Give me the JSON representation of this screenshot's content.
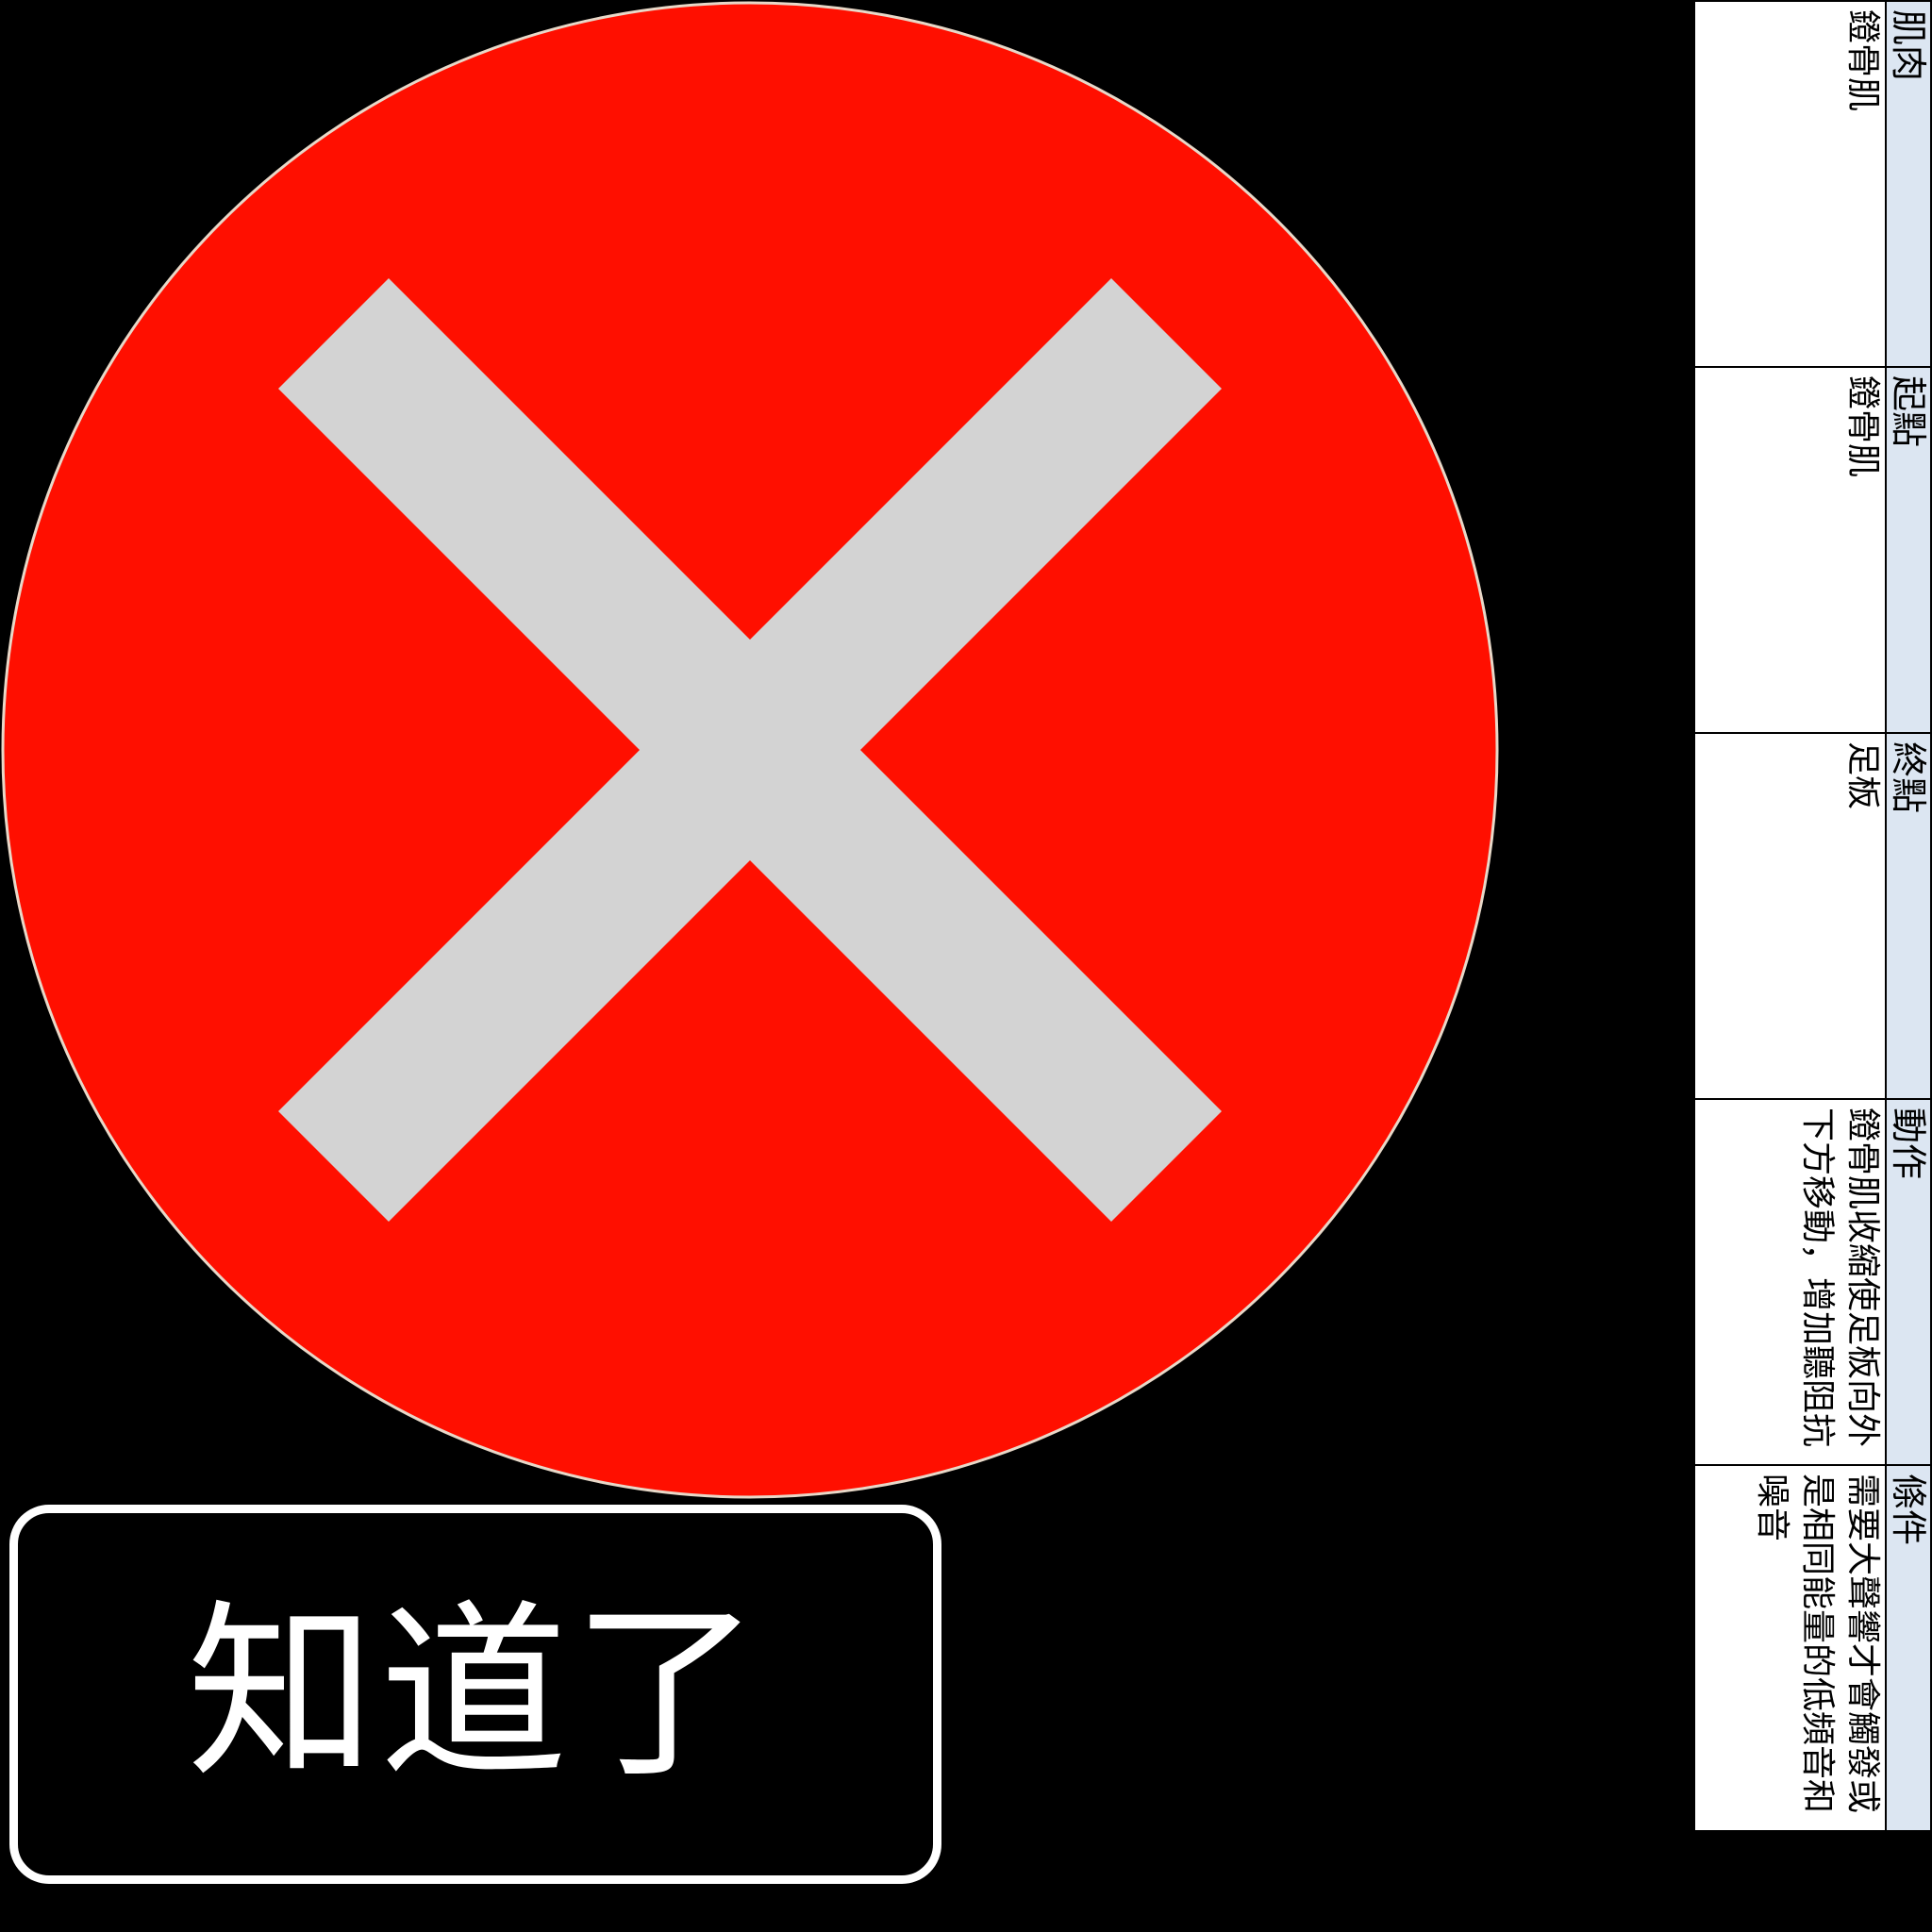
{
  "dialog": {
    "ok_button_label": "知道了"
  },
  "colors": {
    "circle_fill": "#ff0f00",
    "cross_fill": "#d3d3d3",
    "card_header_bg": "#dce6f2",
    "background": "#000000"
  },
  "muscle_card": {
    "columns": [
      {
        "header": "肌肉",
        "value": "鐙骨肌"
      },
      {
        "header": "起點",
        "value": "鐙骨肌"
      },
      {
        "header": "終點",
        "value": "足板"
      },
      {
        "header": "動作",
        "value": "鐙骨肌收縮使足板向外下方移動，增加聽阻抗"
      },
      {
        "header": "條件",
        "value": "需要大聲響才會觸發或是相同能量的低頻音和噪音"
      }
    ]
  }
}
